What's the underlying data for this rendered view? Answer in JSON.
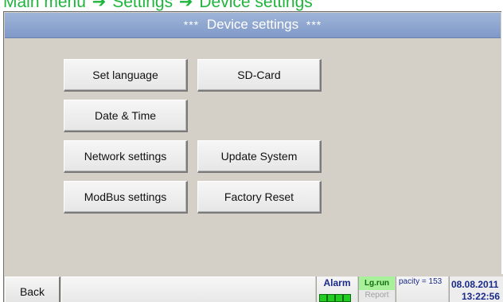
{
  "breadcrumb": {
    "items": [
      "Main menu",
      "Settings",
      "Device settings"
    ],
    "separator": "➔"
  },
  "titlebar": {
    "stars_left": "***",
    "title": "Device settings",
    "stars_right": "***"
  },
  "buttons": {
    "set_language": "Set language",
    "sd_card": "SD-Card",
    "date_time": "Date & Time",
    "network_settings": "Network settings",
    "update_system": "Update System",
    "modbus_settings": "ModBus settings",
    "factory_reset": "Factory Reset"
  },
  "statusbar": {
    "back": "Back",
    "alarm": "Alarm",
    "lg_run": "Lg.run",
    "report": "Report",
    "capacity": "pacity = 153",
    "date": "08.08.2011",
    "time": "13:22:56"
  },
  "colors": {
    "breadcrumb": "#1fb53c",
    "titlebar": "#8aa2cf",
    "status_text": "#1a2a8a",
    "led": "#22cc22"
  }
}
